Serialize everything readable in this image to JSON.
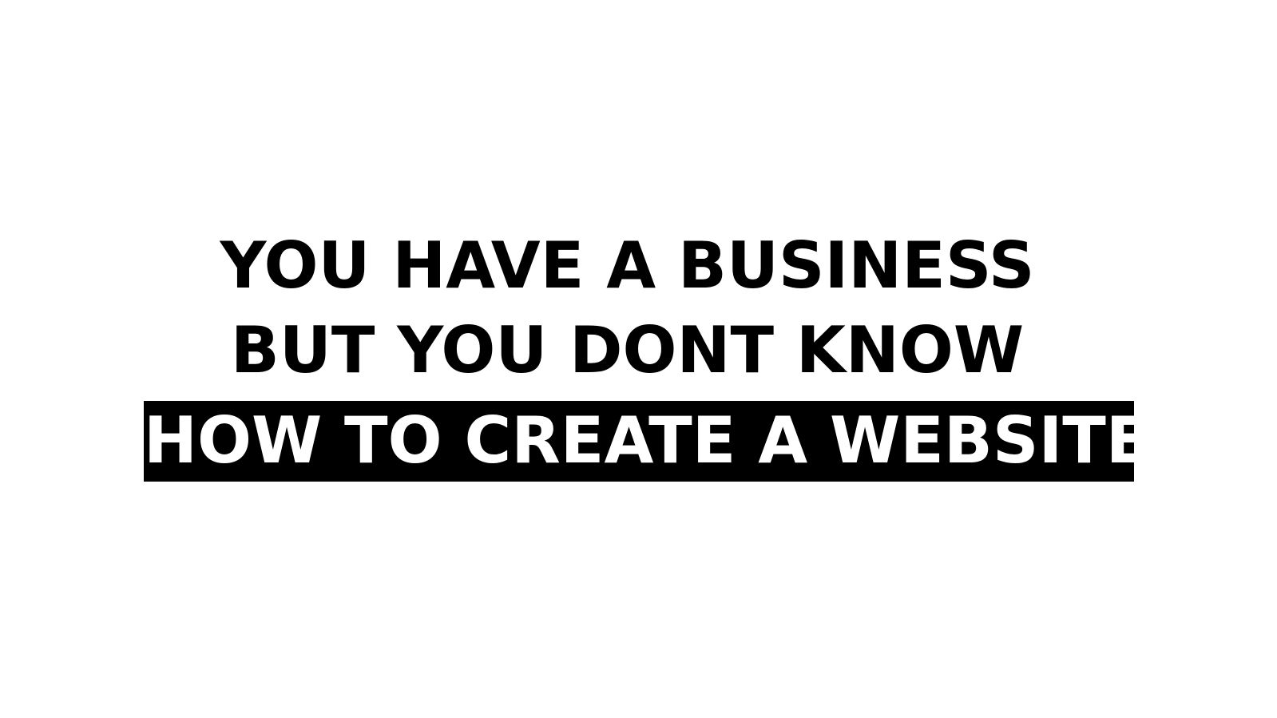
{
  "headline": {
    "line1": "YOU HAVE A BUSINESS",
    "line2": "BUT YOU DONT KNOW",
    "line3": "HOW TO CREATE A WEBSITE"
  },
  "colors": {
    "background": "#ffffff",
    "text": "#000000",
    "highlight_background": "#000000",
    "highlight_text": "#ffffff"
  }
}
